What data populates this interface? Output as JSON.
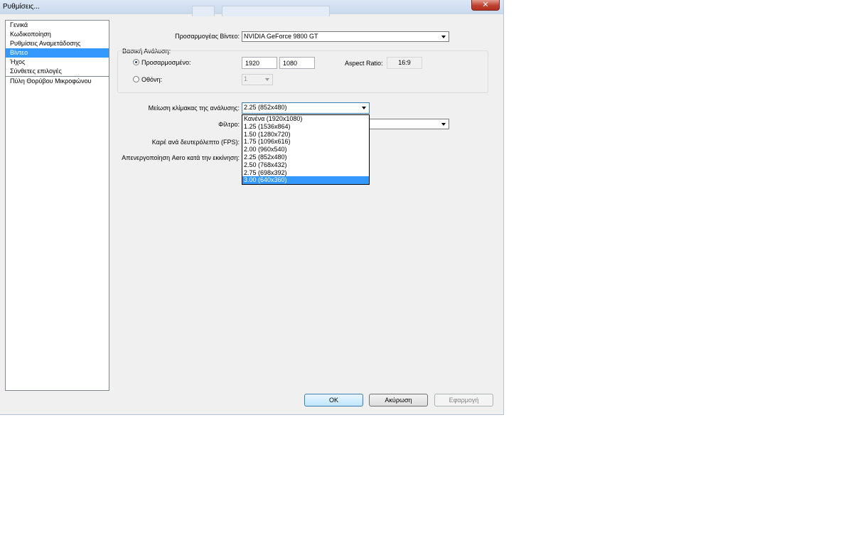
{
  "window": {
    "title": "Ρυθμίσεις...",
    "close_glyph": "✕"
  },
  "sidebar": {
    "items": [
      {
        "label": "Γενικά"
      },
      {
        "label": "Κωδικοποίηση"
      },
      {
        "label": "Ρυθμίσεις Αναμετάδοσης"
      },
      {
        "label": "Βίντεο"
      },
      {
        "label": "Ήχος"
      },
      {
        "label": "Σύνθετες επιλογές"
      },
      {
        "label": "Πύλη Θορύβου Μικροφώνου"
      }
    ],
    "selected": "Βίντεο"
  },
  "video": {
    "adapter_label": "Προσαρμογέας Βίντεο:",
    "adapter_value": "NVIDIA GeForce 9800 GT",
    "base_resolution_label": "Βασική Ανάλυση:",
    "custom_label": "Προσαρμοσμένο:",
    "custom_width": "1920",
    "custom_height": "1080",
    "aspect_label": "Aspect Ratio:",
    "aspect_value": "16:9",
    "monitor_label": "Οθόνη:",
    "monitor_value": "1",
    "downscale_label": "Μείωση κλίμακας της ανάλυσης:",
    "downscale_value": "2.25  (852x480)",
    "filter_label": "Φίλτρο:",
    "fps_label": "Καρέ ανά δευτερόλεπτο (FPS):",
    "aero_label": "Απενεργοποίηση Aero κατά την εκκίνηση:",
    "downscale_options": [
      "Κανένα  (1920x1080)",
      "1.25  (1536x864)",
      "1.50  (1280x720)",
      "1.75  (1096x616)",
      "2.00  (960x540)",
      "2.25  (852x480)",
      "2.50  (768x432)",
      "2.75  (698x392)",
      "3.00  (640x360)"
    ],
    "downscale_highlighted": "3.00  (640x360)"
  },
  "buttons": {
    "ok": "OK",
    "cancel": "Ακύρωση",
    "apply": "Εφαρμογή"
  },
  "colors": {
    "selection": "#3399ff",
    "close_button": "#c0412f"
  }
}
